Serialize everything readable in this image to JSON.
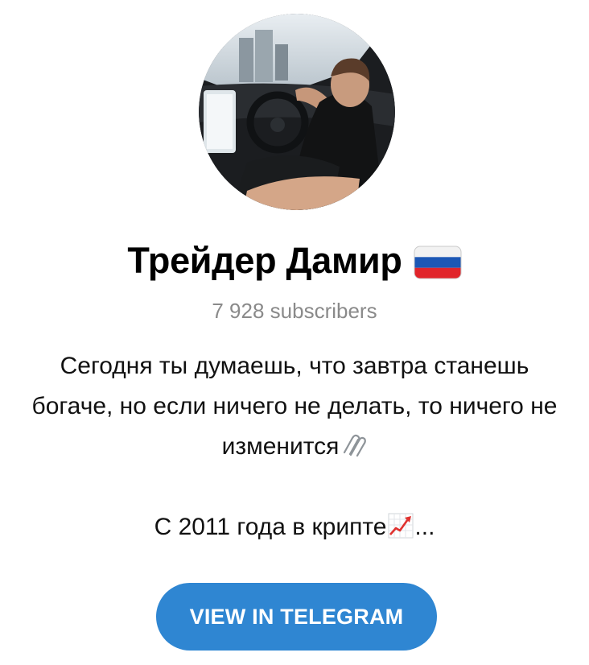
{
  "channel": {
    "title": "Трейдер Дамир",
    "flag_icon": "russia-flag-icon",
    "subscribers": "7 928 subscribers",
    "avatar_icon": "channel-avatar-photo"
  },
  "description": {
    "line1": "Сегодня ты думаешь, что завтра станешь",
    "line2": "богаче, но если ничего не делать, то ничего не",
    "line3": "изменится",
    "line3_icon": "paperclips-icon",
    "line5": "С 2011 года в крипте",
    "line5_icon": "chart-increasing-icon",
    "line5_suffix": "..."
  },
  "cta": {
    "label": "VIEW IN TELEGRAM"
  },
  "colors": {
    "button": "#2f86d2",
    "subscribers_text": "#8a8a8a",
    "background": "#ffffff"
  }
}
